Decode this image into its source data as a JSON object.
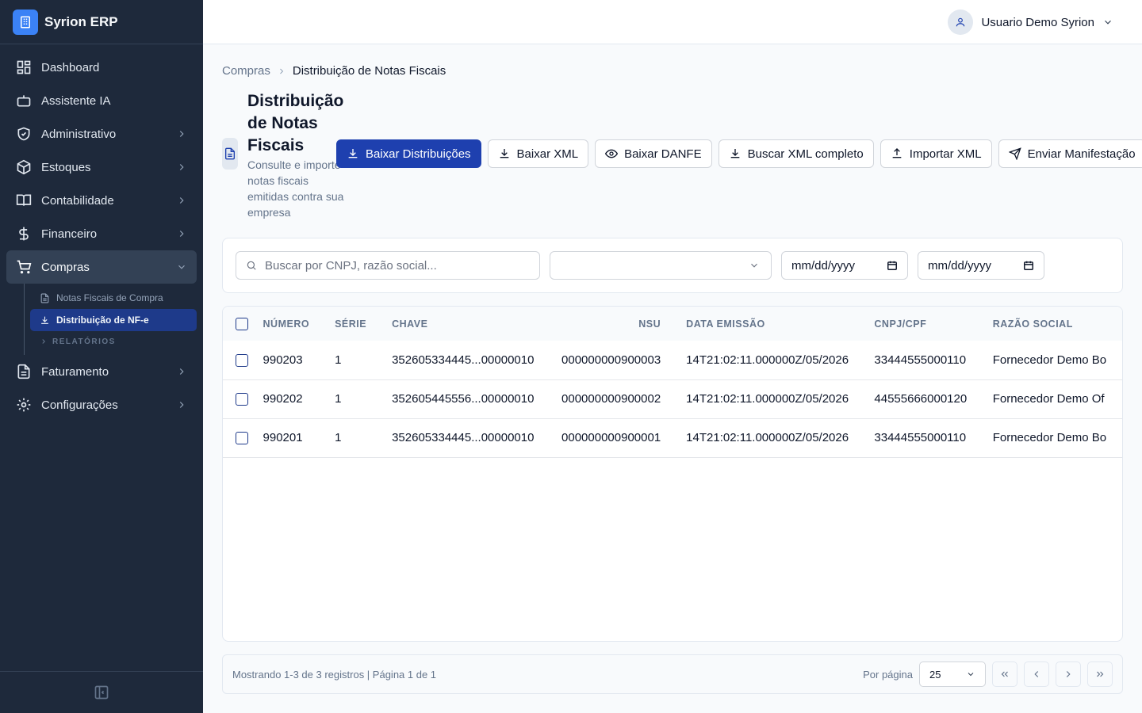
{
  "app": {
    "name": "Syrion ERP"
  },
  "sidebar": {
    "items": [
      {
        "label": "Dashboard",
        "icon": "dashboard-icon"
      },
      {
        "label": "Assistente IA",
        "icon": "bot-icon"
      },
      {
        "label": "Administrativo",
        "icon": "shield-icon"
      },
      {
        "label": "Estoques",
        "icon": "package-icon"
      },
      {
        "label": "Contabilidade",
        "icon": "book-icon"
      },
      {
        "label": "Financeiro",
        "icon": "dollar-icon"
      },
      {
        "label": "Compras",
        "icon": "cart-icon"
      },
      {
        "label": "Faturamento",
        "icon": "file-icon"
      },
      {
        "label": "Configurações",
        "icon": "gear-icon"
      }
    ],
    "sub_items": [
      {
        "label": "Notas Fiscais de Compra"
      },
      {
        "label": "Distribuição de NF-e"
      }
    ],
    "sub_group": "RELATÓRIOS"
  },
  "header": {
    "user_name": "Usuario Demo Syrion"
  },
  "breadcrumb": {
    "parent": "Compras",
    "current": "Distribuição de Notas Fiscais"
  },
  "page": {
    "title_lines": [
      "Distribuição",
      "de Notas",
      "Fiscais"
    ],
    "subtitle_lines": [
      "Consulte e importe",
      "notas fiscais",
      "emitidas contra sua",
      "empresa"
    ]
  },
  "actions": {
    "download_distributions": "Baixar Distribuições",
    "download_xml": "Baixar XML",
    "download_danfe": "Baixar DANFE",
    "fetch_full_xml": "Buscar XML completo",
    "import_xml": "Importar XML",
    "send_manifestation": "Enviar Manifestação"
  },
  "filters": {
    "search_placeholder": "Buscar por CNPJ, razão social...",
    "status_value": "",
    "date_from": "mm/dd/yyyy",
    "date_to": "mm/dd/yyyy"
  },
  "table": {
    "columns": [
      "Número",
      "Série",
      "Chave",
      "NSU",
      "Data Emissão",
      "CNPJ/CPF",
      "Razão Social"
    ],
    "rows": [
      {
        "numero": "990203",
        "serie": "1",
        "chave": "352605334445...00000010",
        "nsu": "000000000900003",
        "data": "14T21:02:11.000000Z/05/2026",
        "cnpj": "33444555000110",
        "razao": "Fornecedor Demo Bo"
      },
      {
        "numero": "990202",
        "serie": "1",
        "chave": "352605445556...00000010",
        "nsu": "000000000900002",
        "data": "14T21:02:11.000000Z/05/2026",
        "cnpj": "44555666000120",
        "razao": "Fornecedor Demo Of"
      },
      {
        "numero": "990201",
        "serie": "1",
        "chave": "352605334445...00000010",
        "nsu": "000000000900001",
        "data": "14T21:02:11.000000Z/05/2026",
        "cnpj": "33444555000110",
        "razao": "Fornecedor Demo Bo"
      }
    ]
  },
  "pagination": {
    "summary": "Mostrando 1-3 de 3 registros | Página 1 de 1",
    "per_page_label": "Por página",
    "per_page_value": "25"
  },
  "colors": {
    "sidebar_bg": "#1e293b",
    "primary": "#1e40af",
    "accent": "#3b82f6"
  }
}
